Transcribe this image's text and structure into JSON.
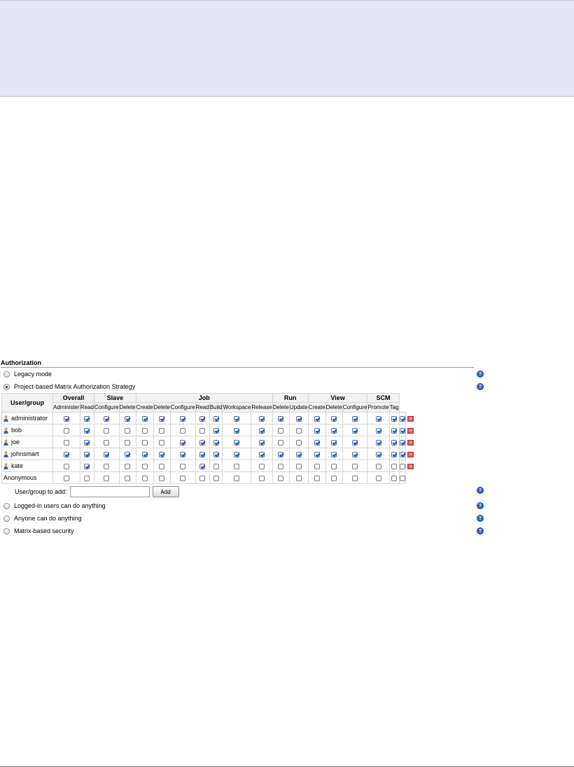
{
  "authorization": {
    "title": "Authorization",
    "options": [
      {
        "label": "Legacy mode",
        "checked": false
      },
      {
        "label": "Project-based Matrix Authorization Strategy",
        "checked": true
      },
      {
        "label": "Logged-in users can do anything",
        "checked": false
      },
      {
        "label": "Anyone can do anything",
        "checked": false
      },
      {
        "label": "Matrix-based security",
        "checked": false
      }
    ],
    "help_icon": "?"
  },
  "matrix": {
    "user_header": "User/group",
    "groups": [
      {
        "name": "Overall",
        "permissions": [
          "Administer",
          "Read"
        ]
      },
      {
        "name": "Slave",
        "permissions": [
          "Configure",
          "Delete"
        ]
      },
      {
        "name": "Job",
        "permissions": [
          "Create",
          "Delete",
          "Configure",
          "Read",
          "Build",
          "Workspace",
          "Release"
        ]
      },
      {
        "name": "Run",
        "permissions": [
          "Delete",
          "Update"
        ]
      },
      {
        "name": "View",
        "permissions": [
          "Create",
          "Delete",
          "Configure"
        ]
      },
      {
        "name": "SCM",
        "permissions": [
          "Promote",
          "Tag"
        ]
      }
    ],
    "rows": [
      {
        "user": "administrator",
        "icon": "user-icon",
        "removable": true,
        "perms": [
          1,
          1,
          1,
          1,
          1,
          1,
          1,
          1,
          1,
          1,
          1,
          1,
          1,
          1,
          1,
          1,
          1,
          1,
          1
        ]
      },
      {
        "user": "bob",
        "icon": "user-icon",
        "removable": true,
        "perms": [
          0,
          1,
          0,
          0,
          0,
          0,
          0,
          0,
          1,
          1,
          1,
          0,
          0,
          1,
          1,
          1,
          1,
          1,
          1
        ]
      },
      {
        "user": "joe",
        "icon": "user-icon",
        "removable": true,
        "perms": [
          0,
          1,
          0,
          0,
          0,
          0,
          1,
          1,
          1,
          1,
          1,
          0,
          0,
          1,
          1,
          1,
          1,
          1,
          1
        ]
      },
      {
        "user": "johnsmart",
        "icon": "user-icon",
        "removable": true,
        "perms": [
          1,
          1,
          1,
          1,
          1,
          1,
          1,
          1,
          1,
          1,
          1,
          1,
          1,
          1,
          1,
          1,
          1,
          1,
          1
        ]
      },
      {
        "user": "kate",
        "icon": "user-icon",
        "removable": true,
        "perms": [
          0,
          1,
          0,
          0,
          0,
          0,
          0,
          1,
          0,
          0,
          0,
          0,
          0,
          0,
          0,
          0,
          0,
          0,
          0
        ]
      },
      {
        "user": "Anonymous",
        "icon": null,
        "removable": false,
        "perms": [
          0,
          0,
          0,
          0,
          0,
          0,
          0,
          0,
          0,
          0,
          0,
          0,
          0,
          0,
          0,
          0,
          0,
          0,
          0
        ]
      }
    ]
  },
  "add_user": {
    "label": "User/group to add:",
    "value": "",
    "button_label": "Add"
  },
  "colors": {
    "header_band": "#e5e5f8",
    "help_icon": "#2b66c2",
    "delete_icon": "#e06060",
    "checkmark": "#1d4fa3"
  }
}
